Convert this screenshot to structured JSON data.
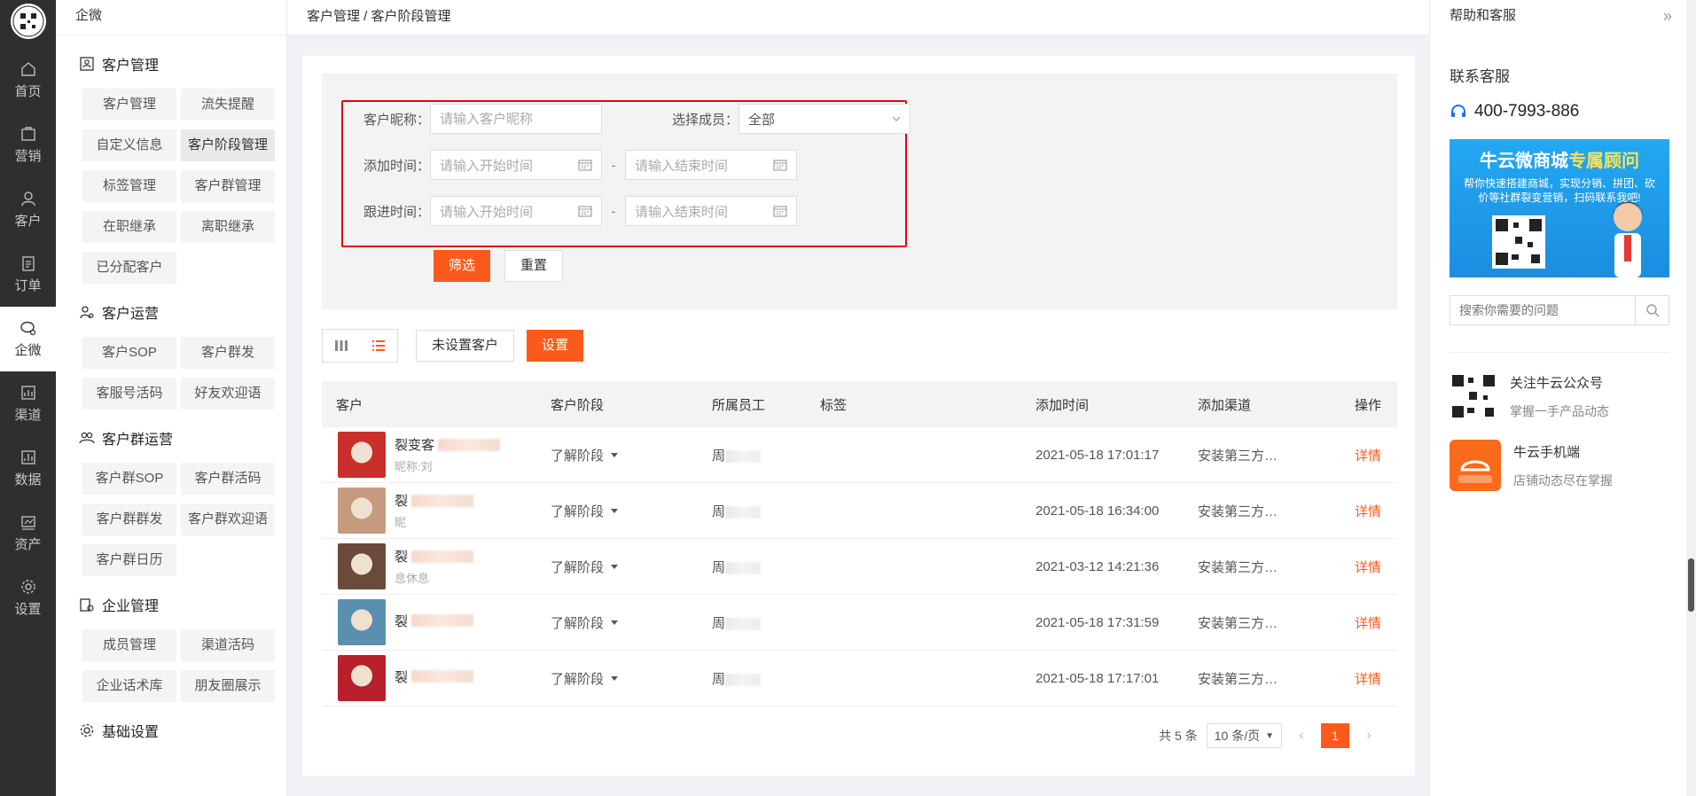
{
  "rail": {
    "items": [
      {
        "label": "首页",
        "icon": "home-icon"
      },
      {
        "label": "营销",
        "icon": "marketing-icon"
      },
      {
        "label": "客户",
        "icon": "user-icon"
      },
      {
        "label": "订单",
        "icon": "order-icon"
      },
      {
        "label": "企微",
        "icon": "wecom-icon",
        "active": true
      },
      {
        "label": "渠道",
        "icon": "channel-icon"
      },
      {
        "label": "数据",
        "icon": "data-icon"
      },
      {
        "label": "资产",
        "icon": "asset-icon"
      },
      {
        "label": "设置",
        "icon": "gear-icon"
      }
    ]
  },
  "side": {
    "title": "企微",
    "groups": [
      {
        "title": "客户管理",
        "items": [
          "客户管理",
          "流失提醒",
          "自定义信息",
          "客户阶段管理",
          "标签管理",
          "客户群管理",
          "在职继承",
          "离职继承",
          "已分配客户"
        ]
      },
      {
        "title": "客户运营",
        "items": [
          "客户SOP",
          "客户群发",
          "客服号活码",
          "好友欢迎语"
        ]
      },
      {
        "title": "客户群运营",
        "items": [
          "客户群SOP",
          "客户群活码",
          "客户群群发",
          "客户群欢迎语",
          "客户群日历"
        ]
      },
      {
        "title": "企业管理",
        "items": [
          "成员管理",
          "渠道活码",
          "企业话术库",
          "朋友圈展示"
        ]
      },
      {
        "title": "基础设置",
        "items": []
      }
    ]
  },
  "breadcrumb": "客户管理 / 客户阶段管理",
  "filter": {
    "nickname_label": "客户昵称：",
    "nickname_placeholder": "请输入客户昵称",
    "member_label": "选择成员：",
    "member_value": "全部",
    "add_time_label": "添加时间：",
    "follow_time_label": "跟进时间：",
    "start_placeholder": "请输入开始时间",
    "end_placeholder": "请输入结束时间",
    "dash": "-",
    "filter_button": "筛选",
    "reset_button": "重置"
  },
  "toolbar": {
    "unset_button": "未设置客户",
    "set_button": "设置"
  },
  "table": {
    "headers": [
      "客户",
      "客户阶段",
      "所属员工",
      "标签",
      "添加时间",
      "添加渠道",
      "操作"
    ],
    "rows": [
      {
        "name": "裂变客",
        "nick": "昵称:刘",
        "stage": "了解阶段",
        "staff": "周",
        "tag": "",
        "time": "2021-05-18 17:01:17",
        "channel": "安装第三方…",
        "action": "详情",
        "avatar": "#c9302c"
      },
      {
        "name": "裂",
        "nick": "昵",
        "stage": "了解阶段",
        "staff": "周",
        "tag": "",
        "time": "2021-05-18 16:34:00",
        "channel": "安装第三方…",
        "action": "详情",
        "avatar": "#c59a7e"
      },
      {
        "name": "裂",
        "nick": "息休息",
        "stage": "了解阶段",
        "staff": "周",
        "tag": "",
        "time": "2021-03-12 14:21:36",
        "channel": "安装第三方…",
        "action": "详情",
        "avatar": "#6b4a3a"
      },
      {
        "name": "裂",
        "nick": "",
        "stage": "了解阶段",
        "staff": "周",
        "tag": "",
        "time": "2021-05-18 17:31:59",
        "channel": "安装第三方…",
        "action": "详情",
        "avatar": "#5b8fb0"
      },
      {
        "name": "裂",
        "nick": "",
        "stage": "了解阶段",
        "staff": "周",
        "tag": "",
        "time": "2021-05-18 17:17:01",
        "channel": "安装第三方…",
        "action": "详情",
        "avatar": "#b8202b"
      }
    ]
  },
  "pager": {
    "total": "共 5 条",
    "page_size": "10 条/页",
    "current": "1"
  },
  "help": {
    "title": "帮助和客服",
    "contact_title": "联系客服",
    "phone": "400-7993-886",
    "banner_title_a": "牛云微商城",
    "banner_title_b": "专属顾问",
    "banner_text": "帮你快速搭建商城，实现分销、拼团、砍价等社群裂变营销，扫码联系我吧!",
    "search_placeholder": "搜索你需要的问题",
    "items": [
      {
        "title": "关注牛云公众号",
        "desc": "掌握一手产品动态"
      },
      {
        "title": "牛云手机端",
        "desc": "店铺动态尽在掌握"
      }
    ]
  },
  "colors": {
    "accent": "#fa5a1b",
    "rail": "#2f2f2f",
    "highlight": "#e60012"
  }
}
